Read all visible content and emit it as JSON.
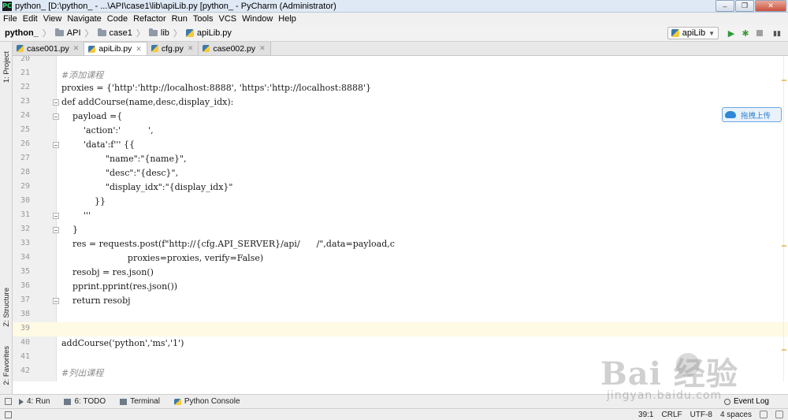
{
  "window": {
    "title": "python_   [D:\\python_   - ...\\API\\case1\\lib\\apiLib.py [python_    - PyCharm (Administrator)",
    "app_icon_text": "PC",
    "controls": [
      "–",
      "❐",
      "✕"
    ]
  },
  "menu": [
    "File",
    "Edit",
    "View",
    "Navigate",
    "Code",
    "Refactor",
    "Run",
    "Tools",
    "VCS",
    "Window",
    "Help"
  ],
  "breadcrumb": {
    "root": "python_",
    "items": [
      "API",
      "case1",
      "lib",
      "apiLib.py"
    ]
  },
  "toolbar": {
    "run_config": "apiLib",
    "run_icon": "▶",
    "debug_icon": "✱",
    "split_icon": "▮▮"
  },
  "side_tabs": {
    "project": "1: Project",
    "structure": "Z: Structure",
    "favorites": "2: Favorites"
  },
  "tabs": [
    {
      "label": "case001.py",
      "active": false
    },
    {
      "label": "apiLib.py",
      "active": true
    },
    {
      "label": "cfg.py",
      "active": false
    },
    {
      "label": "case002.py",
      "active": false
    }
  ],
  "editor": {
    "lines": [
      {
        "n": "20",
        "text": ""
      },
      {
        "n": "21",
        "text": "#添加课程"
      },
      {
        "n": "22",
        "text": "proxies = {'http':'http://localhost:8888', 'https':'http://localhost:8888'}"
      },
      {
        "n": "23",
        "text": "def addCourse(name,desc,display_idx):"
      },
      {
        "n": "24",
        "text": "    payload ={"
      },
      {
        "n": "25",
        "text": "        'action':'          ',"
      },
      {
        "n": "26",
        "text": "        'data':f''' {{"
      },
      {
        "n": "27",
        "text": "                \"name\":\"{name}\","
      },
      {
        "n": "28",
        "text": "                \"desc\":\"{desc}\","
      },
      {
        "n": "29",
        "text": "                \"display_idx\":\"{display_idx}\""
      },
      {
        "n": "30",
        "text": "            }}"
      },
      {
        "n": "31",
        "text": "        '''"
      },
      {
        "n": "32",
        "text": "    }"
      },
      {
        "n": "33",
        "text": "    res = requests.post(f\"http://{cfg.API_SERVER}/api/      /\",data=payload,c"
      },
      {
        "n": "34",
        "text": "                        proxies=proxies, verify=False)"
      },
      {
        "n": "35",
        "text": "    resobj = res.json()"
      },
      {
        "n": "36",
        "text": "    pprint.pprint(res.json())"
      },
      {
        "n": "37",
        "text": "    return resobj"
      },
      {
        "n": "38",
        "text": ""
      },
      {
        "n": "39",
        "text": ""
      },
      {
        "n": "40",
        "text": "addCourse('python','ms','1')"
      },
      {
        "n": "41",
        "text": ""
      },
      {
        "n": "42",
        "text": "#列出课程"
      }
    ]
  },
  "upload_button": "拖拽上传",
  "tool_windows": [
    {
      "label": "4: Run"
    },
    {
      "label": "6: TODO"
    },
    {
      "label": "Terminal"
    },
    {
      "label": "Python Console"
    }
  ],
  "event_log": "Event Log",
  "status": {
    "position": "39:1",
    "line_sep": "CRLF",
    "encoding": "UTF-8",
    "indent": "4 spaces"
  },
  "watermark": {
    "main": "Bai  经验",
    "sub": "jingyan.baidu.com"
  }
}
